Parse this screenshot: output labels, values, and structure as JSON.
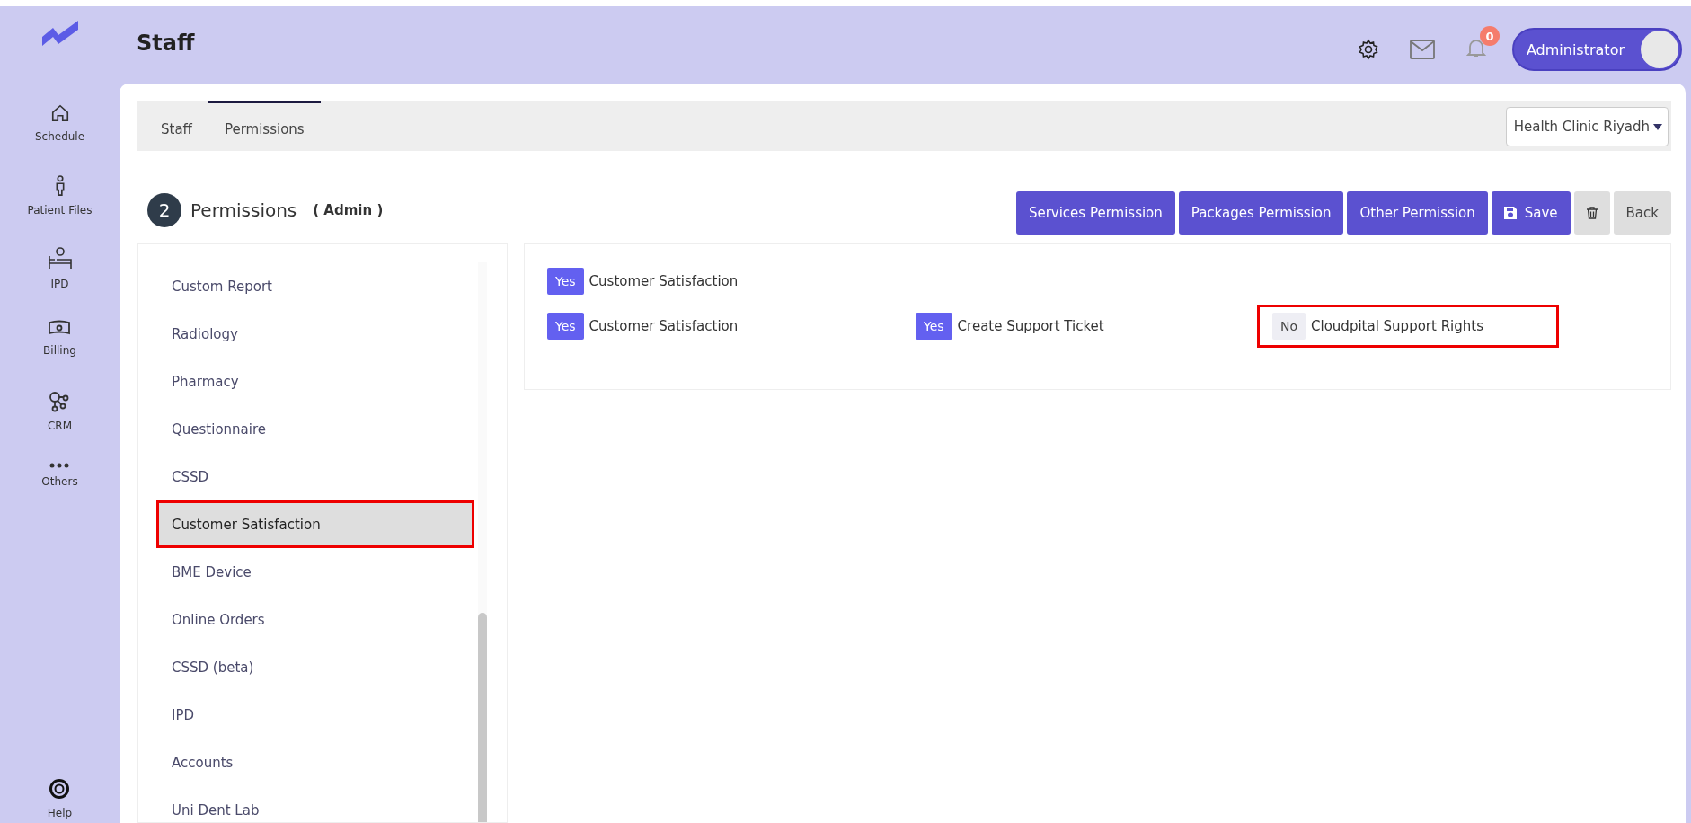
{
  "header": {
    "title": "Staff",
    "notification_count": "0",
    "user": "Administrator"
  },
  "nav": [
    {
      "label": "Schedule"
    },
    {
      "label": "Patient Files"
    },
    {
      "label": "IPD"
    },
    {
      "label": "Billing"
    },
    {
      "label": "CRM"
    },
    {
      "label": "Others"
    }
  ],
  "help": {
    "label": "Help"
  },
  "tabs": [
    {
      "label": "Staff",
      "selected": false
    },
    {
      "label": "Permissions",
      "selected": true
    }
  ],
  "clinic_select": {
    "value": "Health Clinic Riyadh"
  },
  "heading": {
    "step": "2",
    "title": "Permissions",
    "role_open": "(",
    "role": "Admin",
    "role_close": ")"
  },
  "actions": [
    {
      "kind": "primary",
      "label": "Services Permission"
    },
    {
      "kind": "primary",
      "label": "Packages Permission"
    },
    {
      "kind": "primary",
      "label": "Other Permission"
    },
    {
      "kind": "save",
      "label": "Save"
    },
    {
      "kind": "delete"
    },
    {
      "kind": "secondary",
      "label": "Back"
    }
  ],
  "modules": [
    {
      "label": "Custom Report",
      "selected": false,
      "highlighted": false
    },
    {
      "label": "Radiology",
      "selected": false,
      "highlighted": false
    },
    {
      "label": "Pharmacy",
      "selected": false,
      "highlighted": false
    },
    {
      "label": "Questionnaire",
      "selected": false,
      "highlighted": false
    },
    {
      "label": "CSSD",
      "selected": false,
      "highlighted": false
    },
    {
      "label": "Customer Satisfaction",
      "selected": true,
      "highlighted": true
    },
    {
      "label": "BME Device",
      "selected": false,
      "highlighted": false
    },
    {
      "label": "Online Orders",
      "selected": false,
      "highlighted": false
    },
    {
      "label": "CSSD (beta)",
      "selected": false,
      "highlighted": false
    },
    {
      "label": "IPD",
      "selected": false,
      "highlighted": false
    },
    {
      "label": "Accounts",
      "selected": false,
      "highlighted": false
    },
    {
      "label": "Uni Dent Lab",
      "selected": false,
      "highlighted": false
    }
  ],
  "permission_rows": [
    [
      {
        "toggle": "Yes",
        "on": true,
        "label": "Customer Satisfaction",
        "highlighted": false
      }
    ],
    [
      {
        "toggle": "Yes",
        "on": true,
        "label": "Customer Satisfaction",
        "highlighted": false
      },
      {
        "toggle": "Yes",
        "on": true,
        "label": "Create Support Ticket",
        "highlighted": false
      },
      {
        "toggle": "No",
        "on": false,
        "label": "Cloudpital Support Rights",
        "highlighted": true
      }
    ]
  ]
}
